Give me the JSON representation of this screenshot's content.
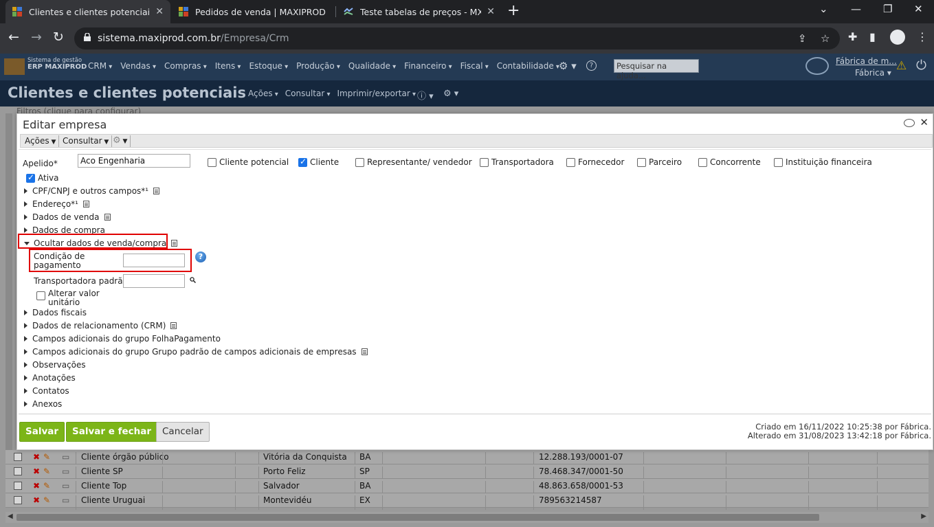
{
  "browser": {
    "tabs": [
      {
        "title": "Clientes e clientes potenciais | Ma",
        "active": true
      },
      {
        "title": "Pedidos de venda | MAXIPROD",
        "active": false
      },
      {
        "title": "Teste tabelas de preços - MXP x M",
        "active": false
      }
    ],
    "url_host": "sistema.maxiprod.com.br",
    "url_path": "/Empresa/Crm"
  },
  "app": {
    "logo_line1": "Sistema de gestão",
    "logo_line2": "ERP MAXIPROD",
    "menus": [
      "CRM",
      "Vendas",
      "Compras",
      "Itens",
      "Estoque",
      "Produção",
      "Qualidade",
      "Financeiro",
      "Fiscal",
      "Contabilidade"
    ],
    "help_search_placeholder": "Pesquisar na ajuda...",
    "user_link": "Fábrica de m...",
    "user_sub": "Fábrica"
  },
  "page": {
    "title": "Clientes e clientes potenciais",
    "menus": [
      "Ações",
      "Consultar",
      "Imprimir/exportar"
    ],
    "filter_hint": "Filtros (clique para configurar)"
  },
  "dialog": {
    "title": "Editar empresa",
    "toolbar": {
      "acoes": "Ações",
      "consultar": "Consultar"
    },
    "apelido_label": "Apelido*",
    "apelido_value": "Aco Engenharia",
    "checkboxes": [
      {
        "label": "Cliente potencial",
        "checked": false
      },
      {
        "label": "Cliente",
        "checked": true
      },
      {
        "label": "Representante/ vendedor",
        "checked": false
      },
      {
        "label": "Transportadora",
        "checked": false
      },
      {
        "label": "Fornecedor",
        "checked": false
      },
      {
        "label": "Parceiro",
        "checked": false
      },
      {
        "label": "Concorrente",
        "checked": false
      },
      {
        "label": "Instituição financeira",
        "checked": false
      }
    ],
    "ativa_label": "Ativa",
    "ativa_checked": true,
    "sections_top": [
      "CPF/CNPJ e outros campos*¹",
      "Endereço*¹",
      "Dados de venda",
      "Dados de compra"
    ],
    "expanded_section": "Ocultar dados de venda/compra",
    "condicao_label_1": "Condição de",
    "condicao_label_2": "pagamento",
    "transportadora_label": "Transportadora padrão",
    "alterar_label_1": "Alterar valor",
    "alterar_label_2": "unitário",
    "sections_bottom": [
      "Dados fiscais",
      "Dados de relacionamento (CRM)",
      "Campos adicionais do grupo FolhaPagamento",
      "Campos adicionais do grupo Grupo padrão de campos adicionais de empresas",
      "Observações",
      "Anotações",
      "Contatos",
      "Anexos"
    ],
    "buttons": {
      "save": "Salvar",
      "save_close": "Salvar e fechar",
      "cancel": "Cancelar"
    },
    "created": "Criado em 16/11/2022 10:25:38 por Fábrica.",
    "modified": "Alterado em 31/08/2023 13:42:18 por Fábrica."
  },
  "background_rows": [
    {
      "name": "Cliente órgão público",
      "city": "Vitória da Conquista",
      "uf": "BA",
      "cnpj": "12.288.193/0001-07"
    },
    {
      "name": "Cliente SP",
      "city": "Porto Feliz",
      "uf": "SP",
      "cnpj": "78.468.347/0001-50"
    },
    {
      "name": "Cliente Top",
      "city": "Salvador",
      "uf": "BA",
      "cnpj": "48.863.658/0001-53"
    },
    {
      "name": "Cliente Uruguai",
      "city": "Montevidéu",
      "uf": "EX",
      "cnpj": "789563214587"
    }
  ]
}
